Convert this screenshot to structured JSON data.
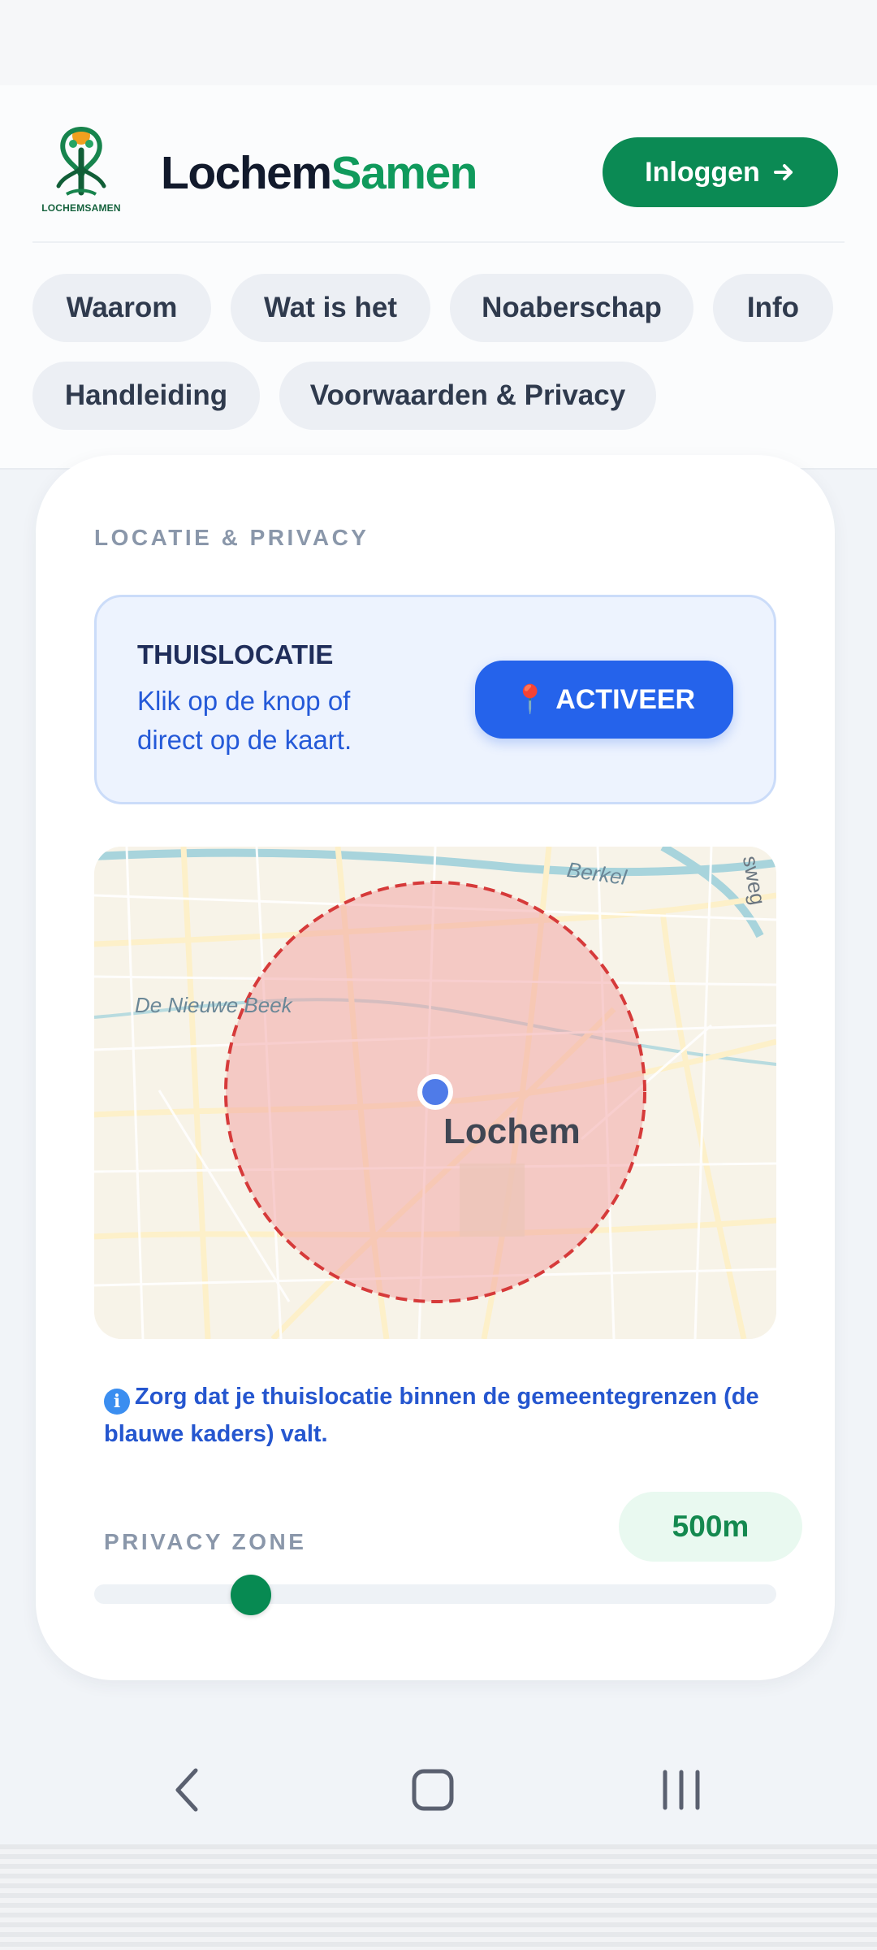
{
  "header": {
    "brand_part1": "Lochem",
    "brand_part2": "Samen",
    "logo_caption": "LOCHEMSAMEN",
    "login_label": "Inloggen",
    "nav_chips": [
      "Waarom",
      "Wat is het",
      "Noaberschap",
      "Info",
      "Handleiding",
      "Voorwaarden & Privacy"
    ]
  },
  "card": {
    "section_title": "LOCATIE & PRIVACY",
    "home_location": {
      "title": "THUISLOCATIE",
      "description": "Klik op de knop of direct op de kaart.",
      "button_icon": "📍",
      "button_label": "ACTIVEER"
    },
    "map": {
      "town_label": "Lochem",
      "water_label_1": "Berkel",
      "water_label_2": "De Nieuwe Beek",
      "street_fragment": "sweg"
    },
    "info_icon": "i",
    "info_note": "Zorg dat je thuislocatie binnen de gemeentegrenzen (de blauwe kaders) valt.",
    "privacy_zone": {
      "label": "PRIVACY ZONE",
      "value": "500m",
      "slider_fraction": 0.23
    }
  },
  "colors": {
    "brand_green": "#109a5c",
    "button_blue": "#2563eb",
    "zone_red": "#d63a3a",
    "location_dot": "#4f7be8"
  },
  "icons": {
    "login_arrow": "arrow-right-icon",
    "nav_back": "back-icon",
    "nav_home": "home-icon",
    "nav_recents": "recents-icon"
  }
}
